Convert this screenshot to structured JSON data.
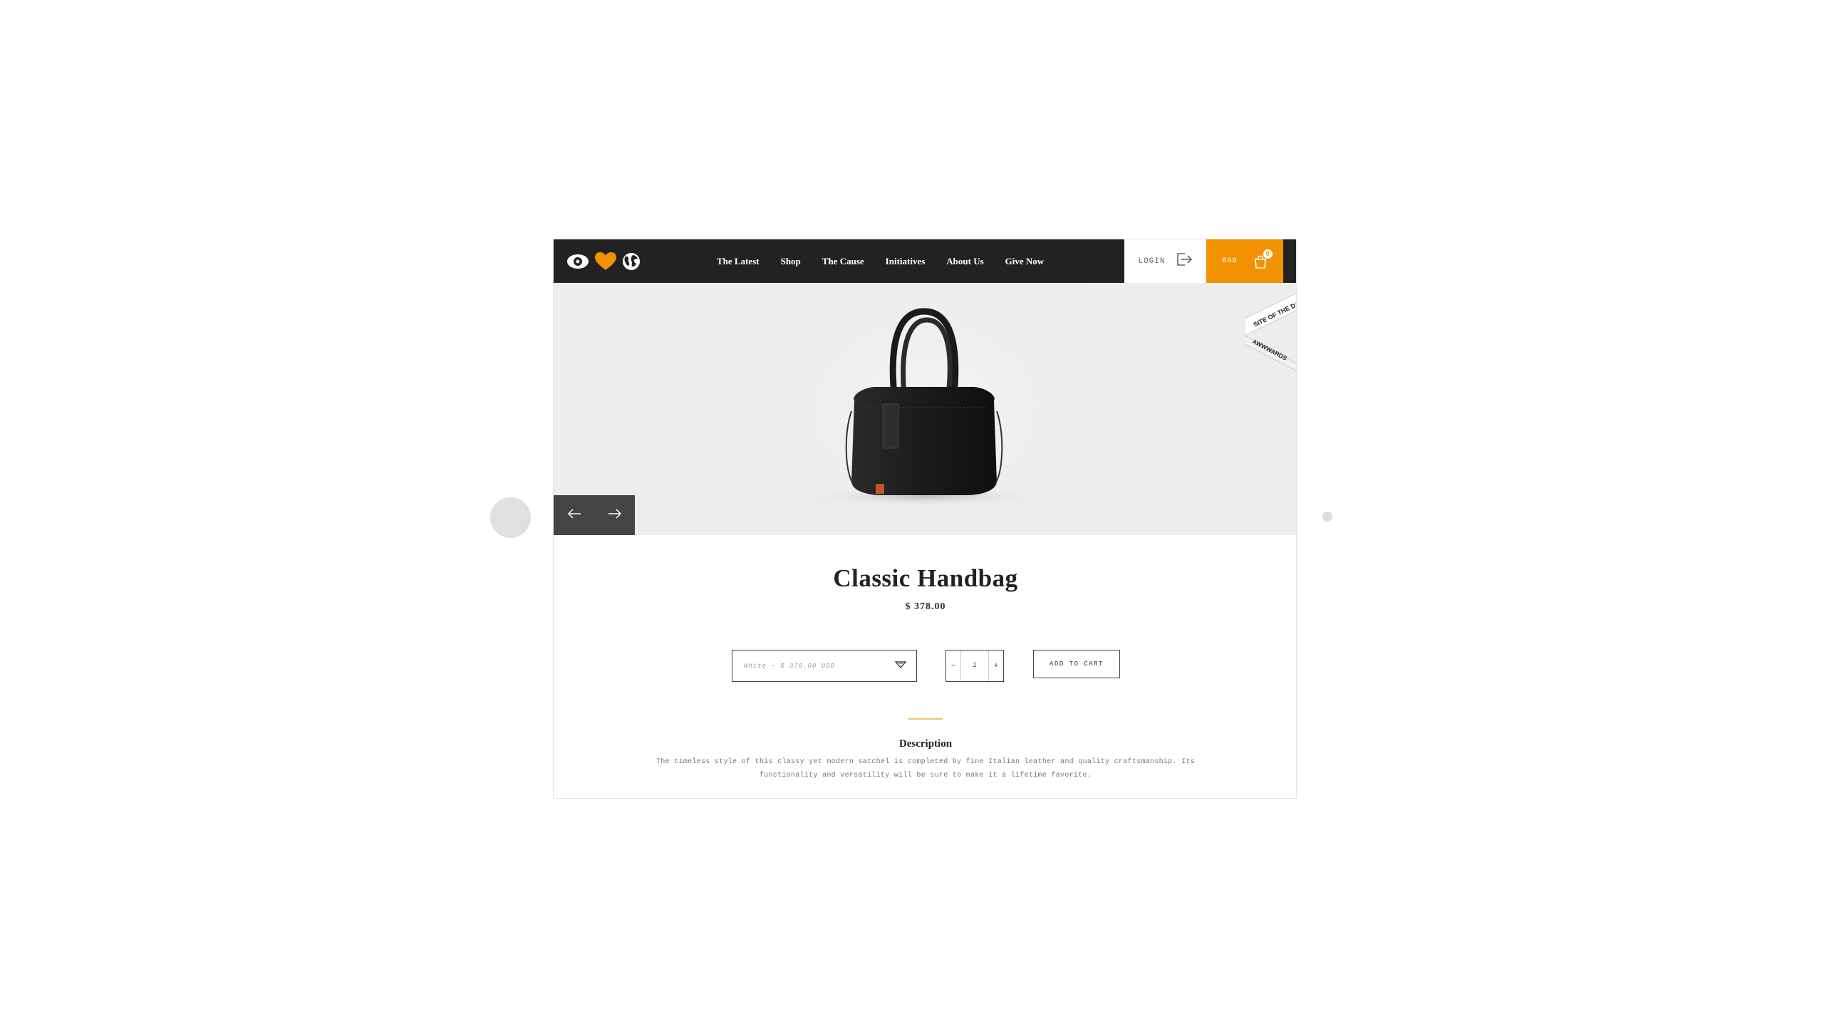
{
  "nav": {
    "links": [
      "The Latest",
      "Shop",
      "The Cause",
      "Initiatives",
      "About Us",
      "Give Now"
    ],
    "login_label": "LOGIN",
    "bag_label": "BAG",
    "bag_count": "0"
  },
  "award": {
    "line1": "SITE OF THE DAY",
    "line2": "AWWWARDS"
  },
  "product": {
    "title": "Classic Handbag",
    "price": "$ 378.00",
    "variant_selected": "White - $ 378.00 USD",
    "quantity": "1",
    "qty_minus": "−",
    "qty_plus": "+",
    "add_to_cart_label": "ADD TO CART"
  },
  "description": {
    "heading": "Description",
    "body": "The timeless style of this classy yet modern satchel is completed by fine Italian leather and quality craftsmanship. Its functionality and versatility will be sure to make it a lifetime favorite."
  },
  "colors": {
    "navbar": "#222222",
    "accent": "#f39200",
    "slider": "#444444"
  }
}
